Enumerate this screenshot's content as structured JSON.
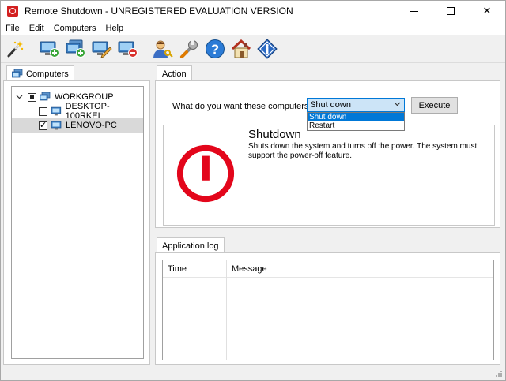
{
  "window": {
    "title": "Remote Shutdown - UNREGISTERED EVALUATION VERSION"
  },
  "menu": [
    "File",
    "Edit",
    "Computers",
    "Help"
  ],
  "toolbar": {
    "buttons": [
      "wizard-icon",
      "add-computer-icon",
      "add-computers-icon",
      "edit-computer-icon",
      "remove-computer-icon",
      "user-credentials-icon",
      "settings-wrench-icon",
      "help-icon",
      "home-icon",
      "info-icon"
    ]
  },
  "computers_panel": {
    "tab_label": "Computers",
    "group": "WORKGROUP",
    "items": [
      {
        "label": "DESKTOP-100RKEI",
        "checked": false
      },
      {
        "label": "LENOVO-PC",
        "checked": true
      }
    ]
  },
  "action_panel": {
    "tab_label": "Action",
    "question": "What do you want these computers to do:",
    "selected": "Shut down",
    "options": [
      "Shut down",
      "Restart"
    ],
    "execute_label": "Execute",
    "desc_title": "Shutdown",
    "desc_text": "Shuts down the system and turns off the power. The system must support the power-off feature."
  },
  "log_panel": {
    "tab_label": "Application log",
    "columns": [
      "Time",
      "Message"
    ]
  },
  "colors": {
    "accent": "#0078d7",
    "power_icon": "#e3061b"
  }
}
